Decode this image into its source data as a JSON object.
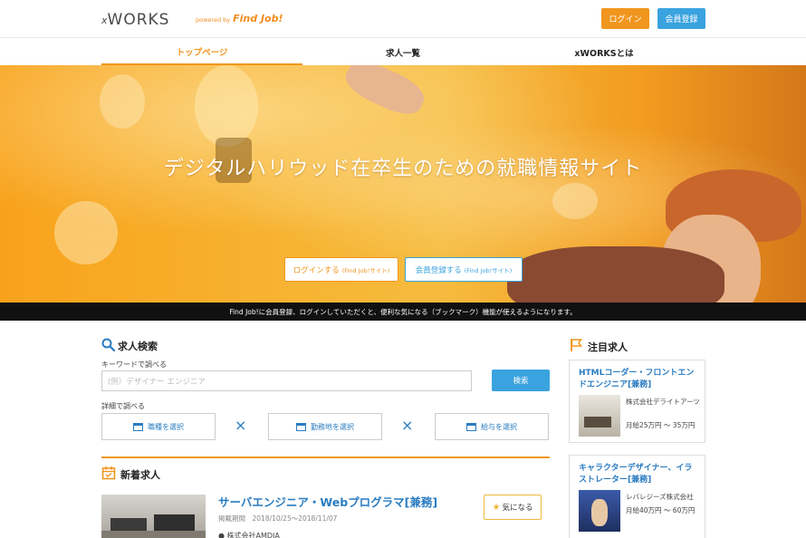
{
  "header": {
    "logo_prefix": "x",
    "logo_main": "WORKS",
    "powered_by": "powered by",
    "findjob": "Find Job!",
    "login_label": "ログイン",
    "register_label": "会員登録",
    "login_color": "#f0961e",
    "register_color": "#3aa3df"
  },
  "nav": {
    "items": [
      {
        "label": "トップページ",
        "active": true
      },
      {
        "label": "求人一覧",
        "active": false
      },
      {
        "label": "xWORKSとは",
        "active": false
      }
    ]
  },
  "hero": {
    "title": "デジタルハリウッド在卒生のための就職情報サイト",
    "login_btn": "ログインする",
    "login_btn_note": "(Find Job!サイト)",
    "register_btn": "会員登録する",
    "register_btn_note": "(Find Job!サイト)"
  },
  "infobar": {
    "text": "Find Job!に会員登録、ログインしていただくと、便利な気になる（ブックマーク）機能が使えるようになります。"
  },
  "search": {
    "title": "求人検索",
    "keyword_label": "キーワードで調べる",
    "placeholder": "(例）デザイナー エンジニア",
    "search_btn": "検索",
    "detail_label": "詳細で調べる",
    "select_buttons": [
      "職種を選択",
      "勤務地を選択",
      "給与を選択"
    ],
    "times_glyph": "×"
  },
  "new_jobs": {
    "title": "新着求人",
    "items": [
      {
        "title": "サーバエンジニア・Webプログラマ[兼務]",
        "date": "掲載期間　2018/10/25〜2018/11/07",
        "company": "● 株式会社AMDIA",
        "fav_label": "気になる"
      }
    ]
  },
  "featured": {
    "title": "注目求人",
    "items": [
      {
        "title": "HTMLコーダー・フロントエンドエンジニア[兼務]",
        "company": "株式会社デライトアーツ",
        "salary": "月給25万円 ～ 35万円"
      },
      {
        "title": "キャラクターデザイナー、イラストレーター[兼務]",
        "company": "レバレジーズ株式会社",
        "salary": "月給40万円 ～ 60万円"
      }
    ]
  },
  "colors": {
    "accent_orange": "#f0961e",
    "accent_blue": "#3aa3df",
    "link_blue": "#2a7cc1"
  }
}
